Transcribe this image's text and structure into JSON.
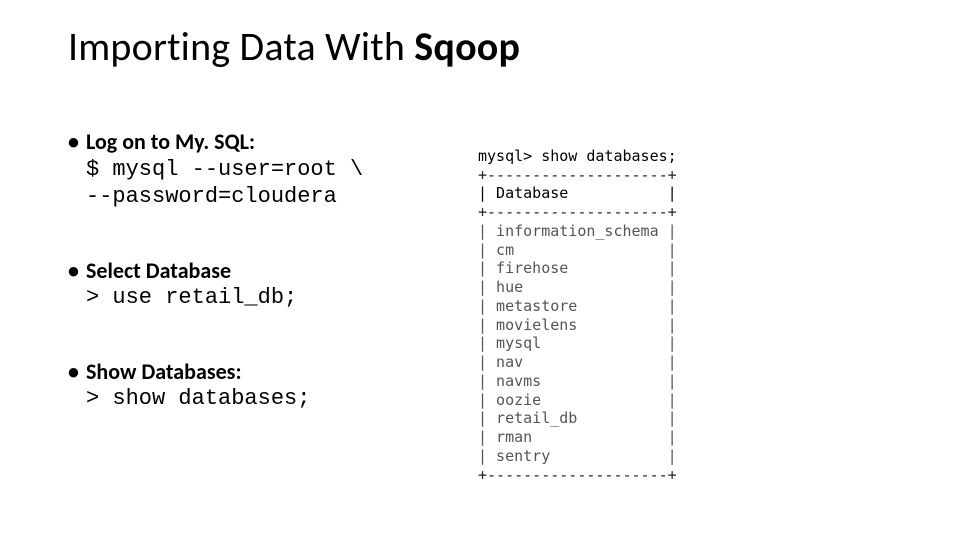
{
  "title": {
    "prefix": "Importing Data With ",
    "bold": "Sqoop"
  },
  "items": [
    {
      "label": "Log on to My. SQL:",
      "code": "$ mysql --user=root \\\n--password=cloudera"
    },
    {
      "label": "Select Database",
      "code": "> use retail_db;"
    },
    {
      "label": "Show Databases:",
      "code": "> show databases;"
    }
  ],
  "terminal": {
    "prompt": "mysql> show databases;",
    "border_top": "+--------------------+",
    "header": "| Database           |",
    "border_header": "+--------------------+",
    "rows": [
      "| information_schema |",
      "| cm                 |",
      "| firehose           |",
      "| hue                |",
      "| metastore          |",
      "| movielens          |",
      "| mysql              |",
      "| nav                |",
      "| navms              |",
      "| oozie              |",
      "| retail_db          |",
      "| rman               |",
      "| sentry             |"
    ],
    "border_bottom": "+--------------------+"
  }
}
